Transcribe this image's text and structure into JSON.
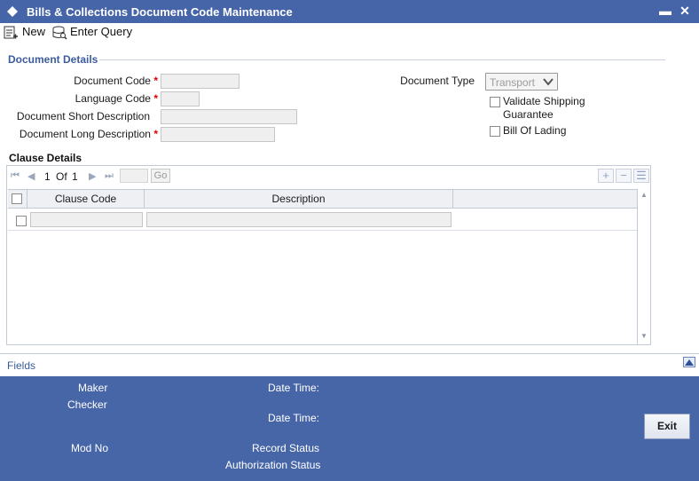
{
  "window": {
    "title": "Bills & Collections Document Code Maintenance",
    "minimize_glyph": "▬",
    "close_glyph": "✕"
  },
  "toolbar": {
    "new_label": "New",
    "enter_query_label": "Enter Query"
  },
  "document_details": {
    "section_title": "Document Details",
    "document_code_label": "Document Code",
    "language_code_label": "Language Code",
    "short_description_label": "Document Short Description",
    "long_description_label": "Document Long Description",
    "required_mark": "*",
    "document_type_label": "Document Type",
    "document_type_value": "Transport",
    "validate_shipping_label_line1": "Validate Shipping",
    "validate_shipping_label_line2": "Guarantee",
    "validate_shipping_checked": false,
    "bill_of_lading_label": "Bill Of Lading",
    "bill_of_lading_checked": false
  },
  "clause_details": {
    "section_title": "Clause Details",
    "pager": {
      "current": "1",
      "of_label": "Of",
      "total": "1"
    },
    "go_label": "Go",
    "columns": [
      "Clause Code",
      "Description"
    ],
    "rows": [
      {
        "clause_code": "",
        "description": ""
      }
    ]
  },
  "fields_bar": {
    "label": "Fields"
  },
  "footer": {
    "maker_label": "Maker",
    "checker_label": "Checker",
    "date_time_label": "Date Time:",
    "mod_no_label": "Mod No",
    "record_status_label": "Record Status",
    "authorization_status_label": "Authorization Status",
    "exit_label": "Exit"
  },
  "colors": {
    "titlebar": "#4664a8",
    "footer": "#4766a7",
    "section_title": "#3a5c9e",
    "required": "#dd0000"
  }
}
